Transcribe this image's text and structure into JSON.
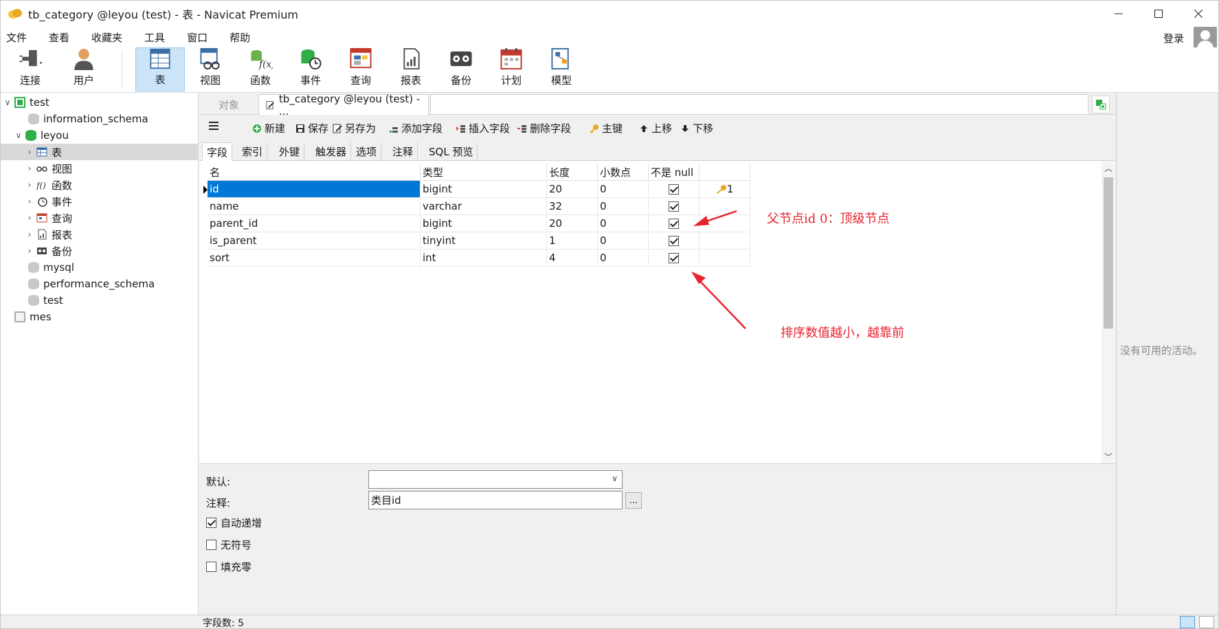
{
  "window": {
    "title": "tb_category @leyou (test) - 表 - Navicat Premium"
  },
  "menu": [
    "文件",
    "查看",
    "收藏夹",
    "工具",
    "窗口",
    "帮助"
  ],
  "login_label": "登录",
  "toolbar": [
    {
      "label": "连接",
      "icon": "plug-icon"
    },
    {
      "label": "用户",
      "icon": "user-icon"
    },
    {
      "label": "表",
      "icon": "table-icon"
    },
    {
      "label": "视图",
      "icon": "view-icon"
    },
    {
      "label": "函数",
      "icon": "function-icon"
    },
    {
      "label": "事件",
      "icon": "event-icon"
    },
    {
      "label": "查询",
      "icon": "query-icon"
    },
    {
      "label": "报表",
      "icon": "report-icon"
    },
    {
      "label": "备份",
      "icon": "backup-icon"
    },
    {
      "label": "计划",
      "icon": "schedule-icon"
    },
    {
      "label": "模型",
      "icon": "model-icon"
    }
  ],
  "tree": [
    {
      "label": "test"
    },
    {
      "label": "information_schema"
    },
    {
      "label": "leyou"
    },
    {
      "label": "表"
    },
    {
      "label": "视图"
    },
    {
      "label": "函数"
    },
    {
      "label": "事件"
    },
    {
      "label": "查询"
    },
    {
      "label": "报表"
    },
    {
      "label": "备份"
    },
    {
      "label": "mysql"
    },
    {
      "label": "performance_schema"
    },
    {
      "label": "test"
    },
    {
      "label": "mes"
    }
  ],
  "tabs": {
    "objects": "对象",
    "active": "tb_category @leyou (test) - ..."
  },
  "actions": [
    "新建",
    "保存",
    "另存为",
    "添加字段",
    "插入字段",
    "删除字段",
    "主键",
    "上移",
    "下移"
  ],
  "subtabs": [
    "字段",
    "索引",
    "外键",
    "触发器",
    "选项",
    "注释",
    "SQL 预览"
  ],
  "columns": [
    "名",
    "类型",
    "长度",
    "小数点",
    "不是 null"
  ],
  "rows": [
    {
      "name": "id",
      "type": "bigint",
      "length": "20",
      "decimals": "0",
      "not_null": true,
      "key": "1"
    },
    {
      "name": "name",
      "type": "varchar",
      "length": "32",
      "decimals": "0",
      "not_null": true,
      "key": ""
    },
    {
      "name": "parent_id",
      "type": "bigint",
      "length": "20",
      "decimals": "0",
      "not_null": true,
      "key": ""
    },
    {
      "name": "is_parent",
      "type": "tinyint",
      "length": "1",
      "decimals": "0",
      "not_null": true,
      "key": ""
    },
    {
      "name": "sort",
      "type": "int",
      "length": "4",
      "decimals": "0",
      "not_null": true,
      "key": ""
    }
  ],
  "annotations": {
    "parent": "父节点id 0：顶级节点",
    "sort": "排序数值越小，越靠前"
  },
  "props": {
    "default_label": "默认:",
    "default_value": "",
    "comment_label": "注释:",
    "comment_value": "类目id",
    "more": "...",
    "auto_increment": "自动递增",
    "unsigned": "无符号",
    "zerofill": "填充零"
  },
  "right_pane": {
    "message": "没有可用的活动。"
  },
  "status": {
    "field_count": "字段数: 5"
  },
  "colors": {
    "accent": "#0078d7",
    "annotation": "#e8232f",
    "db_green": "#2fae4a"
  }
}
